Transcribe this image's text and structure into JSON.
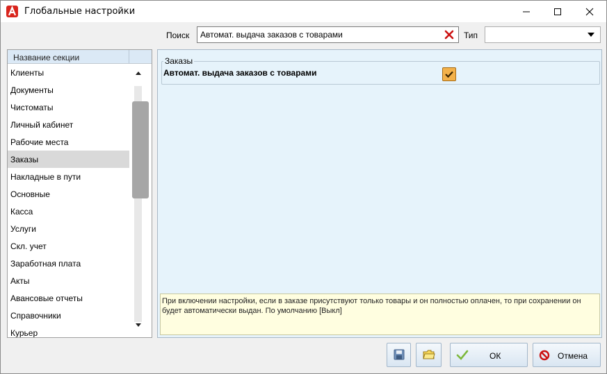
{
  "window": {
    "title": "Глобальные настройки"
  },
  "search": {
    "label": "Поиск",
    "value": "Автомат. выдача заказов с товарами"
  },
  "type_filter": {
    "label": "Тип",
    "value": ""
  },
  "sections": {
    "header": "Название секции",
    "items": [
      "Клиенты",
      "Документы",
      "Чистоматы",
      "Личный кабинет",
      "Рабочие места",
      "Заказы",
      "Накладные в пути",
      "Основные",
      "Касса",
      "Услуги",
      "Скл. учет",
      "Заработная плата",
      "Акты",
      "Авансовые отчеты",
      "Справочники",
      "Курьер"
    ],
    "selected_index": 5
  },
  "settings": {
    "group_title": "Заказы",
    "setting_label": "Автомат. выдача заказов с товарами",
    "setting_checked": true,
    "hint": "При включении настройки, если в заказе присутствуют только товары и он полностью оплачен, то при сохранении он будет автоматически выдан. По умолчанию [Выкл]"
  },
  "buttons": {
    "ok": "ОК",
    "cancel": "Отмена"
  },
  "colors": {
    "accent_orange": "#f3b14a",
    "panel_bg": "#e6f3fb",
    "hint_bg": "#fffee0",
    "close_red": "#cc1111"
  }
}
